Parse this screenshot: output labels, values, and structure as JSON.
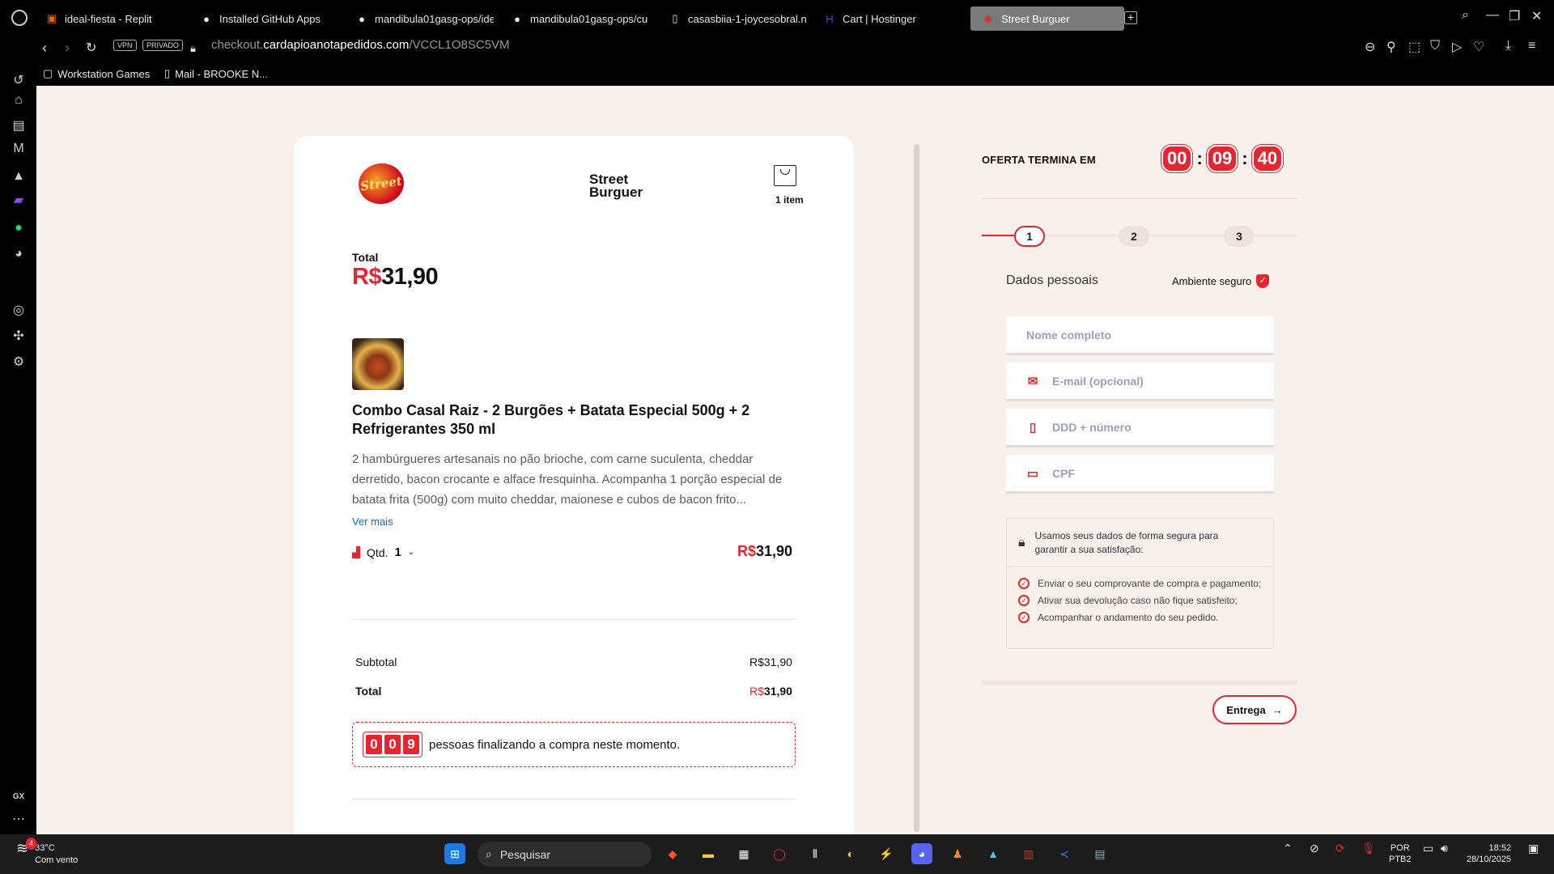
{
  "browser": {
    "tabs": [
      {
        "label": "ideal-fiesta - Replit",
        "icon": "replit-icon"
      },
      {
        "label": "Installed GitHub Apps",
        "icon": "github-icon"
      },
      {
        "label": "mandibula01gasg-ops/ide",
        "icon": "github-icon"
      },
      {
        "label": "mandibula01gasg-ops/cu",
        "icon": "github-icon"
      },
      {
        "label": "casasbiia-1-joycesobral.n",
        "icon": "file-icon"
      },
      {
        "label": "Cart | Hostinger",
        "icon": "hostinger-icon"
      },
      {
        "label": "Street Burguer",
        "icon": "burger-icon"
      }
    ],
    "vpn": "VPN",
    "private": "PRIVADO",
    "url_prefix": "checkout.",
    "url_domain": "cardapioanotapedidos.com",
    "url_path": "/VCCL1O8SC5VM",
    "bookmarks": [
      "Workstation Games",
      "Mail - BROOKE N..."
    ],
    "sidebar_label": "GX"
  },
  "store": {
    "name_line1": "Street",
    "name_line2": "Burguer",
    "logo_text": "Street",
    "cart_count": "1 item"
  },
  "summary": {
    "total_label": "Total",
    "currency": "R$",
    "total_value": "31,90",
    "product_title": "Combo Casal Raiz - 2 Burgões + Batata Especial 500g + 2 Refrigerantes 350 ml",
    "product_desc": "2 hambúrgueres artesanais no pão brioche, com carne suculenta, cheddar derretido, bacon crocante e alface fresquinha. Acompanha 1 porção especial de batata frita (500g) com muito cheddar, maionese e cubos de bacon frito...",
    "see_more": "Ver mais",
    "qty_label": "Qtd.",
    "qty_value": "1",
    "line_price": "31,90",
    "subtotal_label": "Subtotal",
    "subtotal_value": "R$31,90",
    "total2_label": "Total",
    "total2_value": "31,90",
    "people_digits": [
      "0",
      "0",
      "9"
    ],
    "people_text": "pessoas finalizando a compra neste momento."
  },
  "checkout": {
    "offer_label": "OFERTA TERMINA EM",
    "timer": [
      "00",
      "09",
      "40"
    ],
    "steps": [
      "1",
      "2",
      "3"
    ],
    "section_title": "Dados pessoais",
    "secure_label": "Ambiente seguro",
    "fields": {
      "name_placeholder": "Nome completo",
      "email_placeholder": "E-mail (opcional)",
      "phone_placeholder": "DDD + número",
      "cpf_placeholder": "CPF"
    },
    "privacy_intro": "Usamos seus dados de forma segura para garantir a sua satisfação:",
    "privacy_items": [
      "Enviar o seu comprovante de compra e pagamento;",
      "Ativar sua devolução caso não fique satisfeito;",
      "Acompanhar o andamento do seu pedido."
    ],
    "next_button": "Entrega"
  },
  "taskbar": {
    "temp": "33°C",
    "weather": "Com vento",
    "weather_badge": "4",
    "search": "Pesquisar",
    "lang1": "POR",
    "lang2": "PTB2",
    "time": "18:52",
    "date": "28/10/2025"
  },
  "colors": {
    "accent": "#e3262f",
    "page_bg": "#f8f0eb"
  }
}
